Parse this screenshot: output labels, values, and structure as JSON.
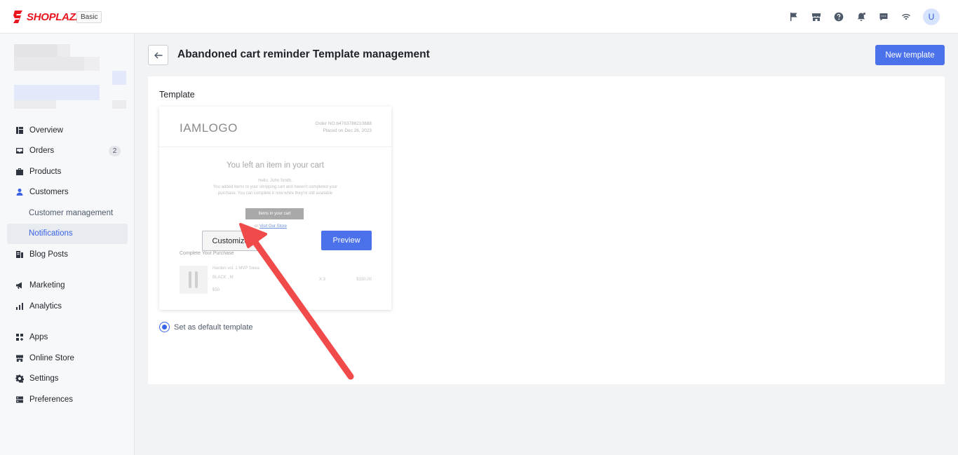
{
  "app": {
    "brand": "SHOPLAZZA",
    "plan_badge": "Basic",
    "avatar_initial": "U"
  },
  "topbar_icons": [
    "flag-icon",
    "store-icon",
    "help-icon",
    "bell-icon",
    "message-icon",
    "wifi-icon"
  ],
  "sidebar": {
    "items": [
      {
        "label": "Overview",
        "icon": "overview-icon"
      },
      {
        "label": "Orders",
        "icon": "orders-icon",
        "count": "2"
      },
      {
        "label": "Products",
        "icon": "products-icon"
      },
      {
        "label": "Customers",
        "icon": "customers-icon"
      },
      {
        "label": "Customer management"
      },
      {
        "label": "Notifications"
      },
      {
        "label": "Blog Posts",
        "icon": "blog-icon"
      },
      {
        "label": "Marketing",
        "icon": "marketing-icon"
      },
      {
        "label": "Analytics",
        "icon": "analytics-icon"
      },
      {
        "label": "Apps",
        "icon": "apps-icon"
      },
      {
        "label": "Online Store",
        "icon": "online-store-icon"
      },
      {
        "label": "Settings",
        "icon": "settings-icon"
      },
      {
        "label": "Preferences",
        "icon": "preferences-icon"
      }
    ]
  },
  "header": {
    "title": "Abandoned cart reminder Template management",
    "new_template_label": "New template"
  },
  "card": {
    "label": "Template",
    "preview": {
      "logo": "IAMLOGO",
      "order_no": "Order NO.64763786210888",
      "placed_on": "Placed on Dec 26, 2023",
      "headline": "You left an item in your cart",
      "greeting": "Hello, John Smith,",
      "body_line1": "You added items to your shopping cart and haven't completed your",
      "body_line2": "purchase. You can complete it now while they're still available",
      "cta": "Items in your cart",
      "or_text": "or",
      "visit_store": "Visit Our Store",
      "section_title": "Complete Your Purchase",
      "product_name": "Harden vol. 1 MVP Swea",
      "product_variant": "BLACK , M",
      "product_price": "$50",
      "product_qty": "X 3",
      "product_total": "$150.00"
    },
    "customize_label": "Customize",
    "preview_label": "Preview",
    "default_label": "Set as default template",
    "default_selected": true
  },
  "colors": {
    "accent": "#4b72ea",
    "brand": "#e8141e",
    "annotation_arrow": "#f04a4a"
  }
}
